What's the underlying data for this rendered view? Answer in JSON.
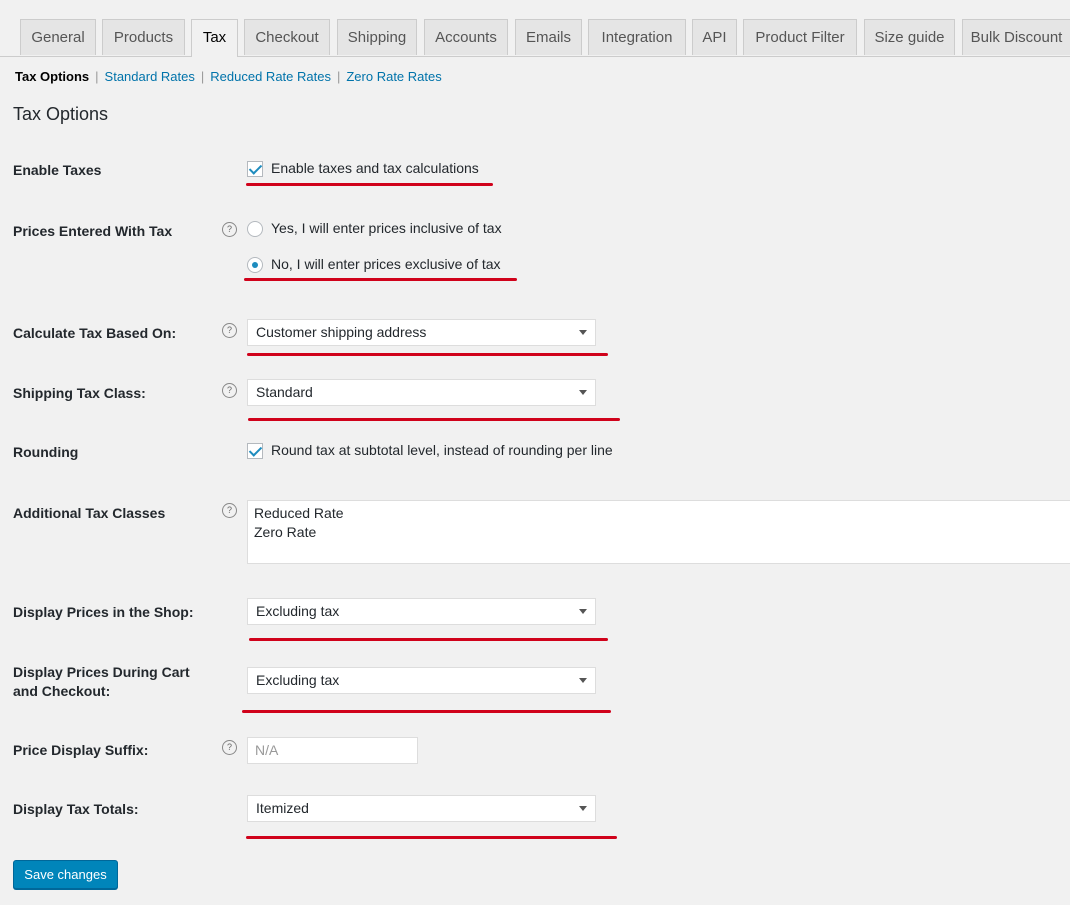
{
  "tabs": [
    "General",
    "Products",
    "Tax",
    "Checkout",
    "Shipping",
    "Accounts",
    "Emails",
    "Integration",
    "API",
    "Product Filter",
    "Size guide",
    "Bulk Discount"
  ],
  "subnav": {
    "current": "Tax Options",
    "links": [
      "Standard Rates",
      "Reduced Rate Rates",
      "Zero Rate Rates"
    ],
    "separator": "|"
  },
  "section_title": "Tax Options",
  "fields": {
    "enable_taxes": {
      "label": "Enable Taxes",
      "checkbox_label": "Enable taxes and tax calculations",
      "checked": true
    },
    "prices_entered": {
      "label": "Prices Entered With Tax",
      "options": [
        "Yes, I will enter prices inclusive of tax",
        "No, I will enter prices exclusive of tax"
      ],
      "selected_index": 1
    },
    "calculate_based_on": {
      "label": "Calculate Tax Based On:",
      "value": "Customer shipping address"
    },
    "shipping_tax_class": {
      "label": "Shipping Tax Class:",
      "value": "Standard"
    },
    "rounding": {
      "label": "Rounding",
      "checkbox_label": "Round tax at subtotal level, instead of rounding per line",
      "checked": true
    },
    "additional_classes": {
      "label": "Additional Tax Classes",
      "lines": [
        "Reduced Rate",
        "Zero Rate"
      ]
    },
    "display_shop": {
      "label": "Display Prices in the Shop:",
      "value": "Excluding tax"
    },
    "display_cart": {
      "label_line1": "Display Prices During Cart",
      "label_line2": "and Checkout:",
      "value": "Excluding tax"
    },
    "price_suffix": {
      "label": "Price Display Suffix:",
      "placeholder": "N/A"
    },
    "display_totals": {
      "label": "Display Tax Totals:",
      "value": "Itemized"
    }
  },
  "help_glyph": "?",
  "save_button": "Save changes",
  "colors": {
    "accent": "#0073aa",
    "button": "#0085ba",
    "annotation": "#d0021b"
  }
}
